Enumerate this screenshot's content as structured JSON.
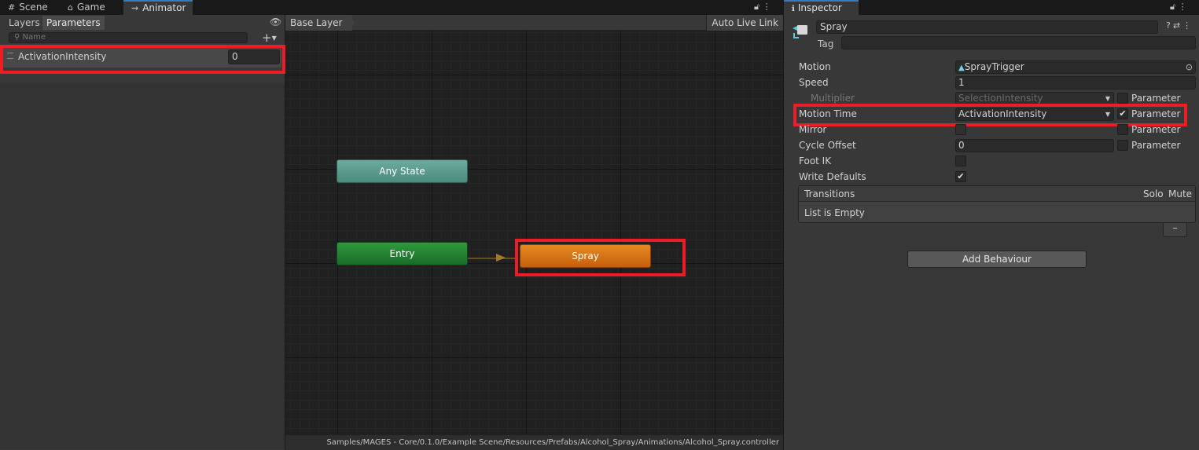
{
  "left_tabs": {
    "scene": "Scene",
    "game": "Game",
    "animator": "Animator"
  },
  "animator": {
    "subtabs": {
      "layers": "Layers",
      "parameters": "Parameters"
    },
    "search_placeholder": "Name",
    "parameter": {
      "name": "ActivationIntensity",
      "value": "0"
    },
    "breadcrumb": "Base Layer",
    "auto_live_link": "Auto Live Link",
    "nodes": {
      "any_state": "Any State",
      "entry": "Entry",
      "spray": "Spray"
    },
    "path": "Samples/MAGES - Core/0.1.0/Example Scene/Resources/Prefabs/Alcohol_Spray/Animations/Alcohol_Spray.controller"
  },
  "inspector": {
    "tab": "Inspector",
    "state_name": "Spray",
    "tag_label": "Tag",
    "rows": {
      "motion": {
        "label": "Motion",
        "value": "SprayTrigger"
      },
      "speed": {
        "label": "Speed",
        "value": "1"
      },
      "multiplier": {
        "label": "Multiplier",
        "value": "SelectionIntensity",
        "param": "Parameter"
      },
      "motion_time": {
        "label": "Motion Time",
        "value": "ActivationIntensity",
        "param": "Parameter",
        "checked": true
      },
      "mirror": {
        "label": "Mirror",
        "param": "Parameter"
      },
      "cycle_offset": {
        "label": "Cycle Offset",
        "value": "0",
        "param": "Parameter"
      },
      "foot_ik": {
        "label": "Foot IK"
      },
      "write_defaults": {
        "label": "Write Defaults",
        "checked": true
      }
    },
    "transitions": {
      "title": "Transitions",
      "solo": "Solo",
      "mute": "Mute",
      "empty": "List is Empty"
    },
    "add_behaviour": "Add Behaviour"
  },
  "colors": {
    "highlight": "#ee1c25",
    "any_state": "#5b9a8c",
    "entry": "#238233",
    "spray": "#d97416"
  }
}
